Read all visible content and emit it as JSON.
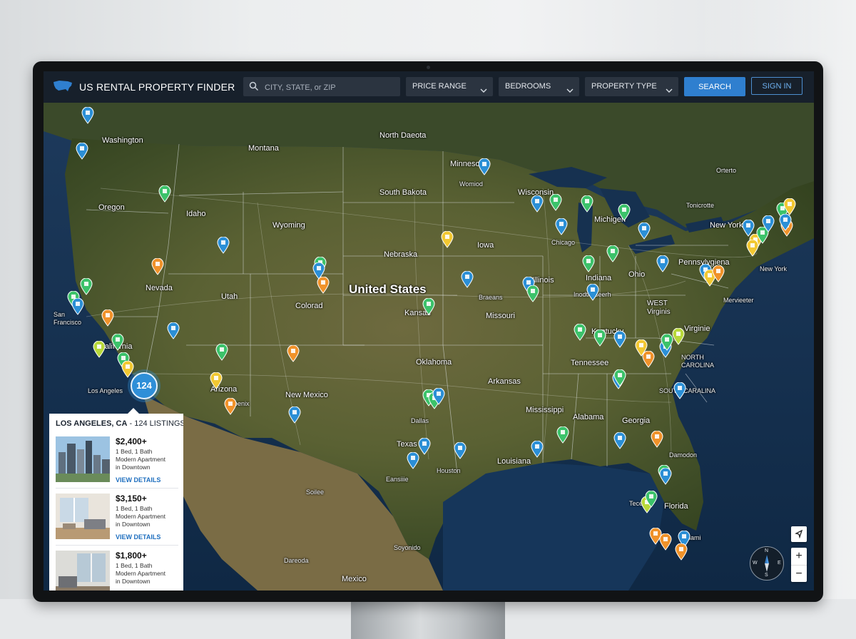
{
  "app": {
    "title": "US RENTAL PROPERTY FINDER",
    "colors": {
      "accent": "#2f7fcf",
      "topbar": "#17202b"
    }
  },
  "search": {
    "placeholder": "CITY, STATE, or ZIP",
    "value": "",
    "icon": "search-icon"
  },
  "filters": [
    {
      "label": "PRICE RANGE"
    },
    {
      "label": "BEDROOMS"
    },
    {
      "label": "PROPERTY TYPE"
    }
  ],
  "buttons": {
    "search": "SEARCH",
    "sign_in": "SIGN IN"
  },
  "map": {
    "country_label": "United States",
    "cluster_count": "124",
    "states": [
      "Washington",
      "Oregon",
      "Idaho",
      "Montana",
      "Wyoming",
      "North Daeota",
      "South Bakota",
      "Nebraska",
      "Kansas",
      "Oklahoma",
      "Texas",
      "New Mexico",
      "Arizona",
      "Utah",
      "Nevada",
      "California",
      "Colorad",
      "Minnesota",
      "Iowa",
      "Missouri",
      "Arkansas",
      "Louisiana",
      "Mississippi",
      "Alabama",
      "Georgia",
      "Tennessee",
      "Kentucky",
      "Illinois",
      "Indiana",
      "Ohio",
      "Wisconsin",
      "Michigen",
      "Pennsylvgiena",
      "WEST Virginis",
      "Virginie",
      "NORTH CAROLINA",
      "SOUTH CARALINA",
      "Florida",
      "New York",
      "Ontario"
    ],
    "cities": [
      "San Francisco",
      "Los Angeles",
      "Phoenix",
      "Dallas",
      "Houston",
      "Chicago",
      "New York",
      "Tonicrotte",
      "Mervieeter",
      "Eansiiie",
      "Braeans",
      "Inodtheseerh",
      "Womiod",
      "Damodon",
      "Teced",
      "Aliami",
      "Soilee",
      "Soyonido",
      "Dareoda",
      "Mexico",
      "Orterto"
    ]
  },
  "listing_panel": {
    "city": "LOS ANGELES, CA",
    "count_text": "- 124 LISTINGS",
    "listings": [
      {
        "price": "$2,400+",
        "beds": "1 Bed, 1 Bath",
        "desc1": "Modern Apartment",
        "desc2": "in Downtown",
        "link": "VIEW DETAILS"
      },
      {
        "price": "$3,150+",
        "beds": "1 Bed, 1 Bath",
        "desc1": "Modern Apartment",
        "desc2": "in Downtown",
        "link": "VIEW DETAILS"
      },
      {
        "price": "$1,800+",
        "beds": "1 Bed, 1 Bath",
        "desc1": "Modern Apartment",
        "desc2": "in Downtown",
        "link": "VIEW DETAILS"
      }
    ]
  },
  "controls": {
    "zoom_in": "+",
    "zoom_out": "−",
    "compass": {
      "n": "N",
      "s": "S",
      "e": "E",
      "w": "W"
    }
  },
  "pin_colors": {
    "blue": "#2b8fd6",
    "green": "#3cc26a",
    "orange": "#f0922a",
    "yellow": "#f2c832",
    "lime": "#b8d83a"
  }
}
